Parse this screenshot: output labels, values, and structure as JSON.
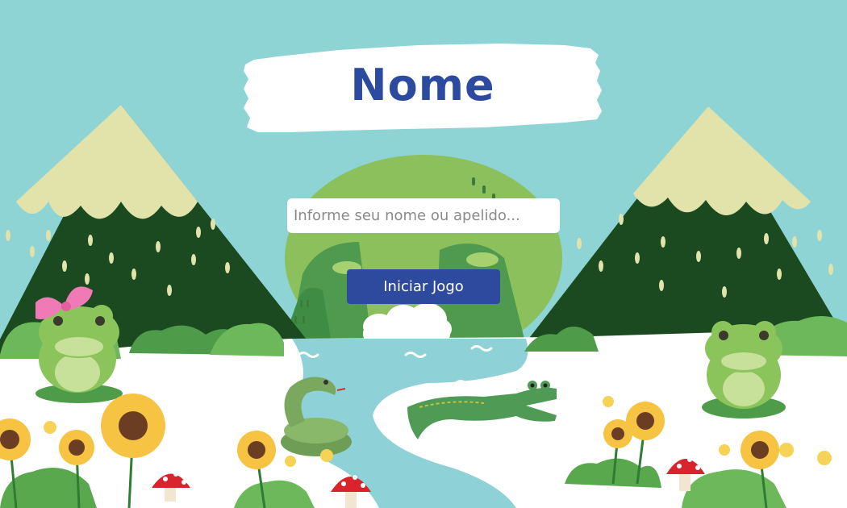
{
  "title": "Nome",
  "name_input": {
    "value": "",
    "placeholder": "Informe seu nome ou apelido..."
  },
  "start_button": {
    "label": "Iniciar Jogo"
  },
  "colors": {
    "sky": "#8fd4d5",
    "title_text": "#2b4aa0",
    "button": "#2e4a9e",
    "mountain": "#1c4a20",
    "snow": "#e1e3ab",
    "hill": "#8bc05c",
    "river": "#8ed1d7",
    "ground": "#ffffff"
  }
}
